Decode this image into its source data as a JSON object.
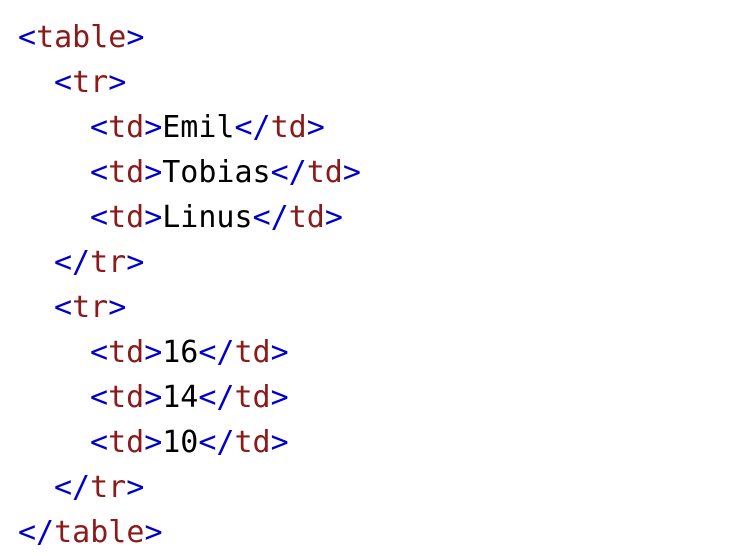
{
  "code": {
    "lines": [
      {
        "indent": 0,
        "open": "<",
        "tag": "table",
        "close": ">",
        "text": "",
        "end_open": "",
        "end_tag": "",
        "end_close": ""
      },
      {
        "indent": 1,
        "open": "<",
        "tag": "tr",
        "close": ">",
        "text": "",
        "end_open": "",
        "end_tag": "",
        "end_close": ""
      },
      {
        "indent": 2,
        "open": "<",
        "tag": "td",
        "close": ">",
        "text": "Emil",
        "end_open": "</",
        "end_tag": "td",
        "end_close": ">"
      },
      {
        "indent": 2,
        "open": "<",
        "tag": "td",
        "close": ">",
        "text": "Tobias",
        "end_open": "</",
        "end_tag": "td",
        "end_close": ">"
      },
      {
        "indent": 2,
        "open": "<",
        "tag": "td",
        "close": ">",
        "text": "Linus",
        "end_open": "</",
        "end_tag": "td",
        "end_close": ">"
      },
      {
        "indent": 1,
        "open": "</",
        "tag": "tr",
        "close": ">",
        "text": "",
        "end_open": "",
        "end_tag": "",
        "end_close": ""
      },
      {
        "indent": 1,
        "open": "<",
        "tag": "tr",
        "close": ">",
        "text": "",
        "end_open": "",
        "end_tag": "",
        "end_close": ""
      },
      {
        "indent": 2,
        "open": "<",
        "tag": "td",
        "close": ">",
        "text": "16",
        "end_open": "</",
        "end_tag": "td",
        "end_close": ">"
      },
      {
        "indent": 2,
        "open": "<",
        "tag": "td",
        "close": ">",
        "text": "14",
        "end_open": "</",
        "end_tag": "td",
        "end_close": ">"
      },
      {
        "indent": 2,
        "open": "<",
        "tag": "td",
        "close": ">",
        "text": "10",
        "end_open": "</",
        "end_tag": "td",
        "end_close": ">"
      },
      {
        "indent": 1,
        "open": "</",
        "tag": "tr",
        "close": ">",
        "text": "",
        "end_open": "",
        "end_tag": "",
        "end_close": ""
      },
      {
        "indent": 0,
        "open": "</",
        "tag": "table",
        "close": ">",
        "text": "",
        "end_open": "",
        "end_tag": "",
        "end_close": ""
      }
    ]
  },
  "colors": {
    "bracket": "#0000cd",
    "tag_name": "#8b1a1a",
    "text": "#000000",
    "background": "#ffffff"
  }
}
